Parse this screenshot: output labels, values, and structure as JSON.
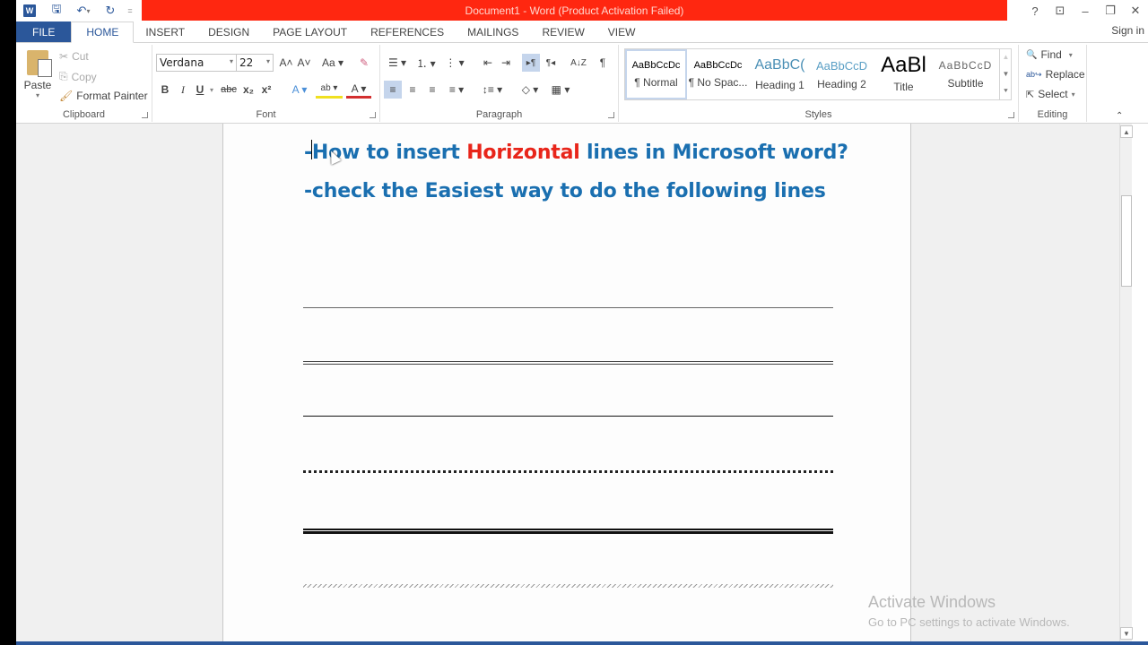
{
  "window": {
    "title": "Document1 -  Word (Product Activation Failed)",
    "controls": {
      "help": "?",
      "ribbon_options": "⊡",
      "minimize": "–",
      "restore": "❐",
      "close": "✕"
    },
    "sign_in": "Sign in"
  },
  "qat": {
    "word_logo": "W",
    "save": "🖫",
    "undo": "↶",
    "undo_dd": "▾",
    "redo": "↻",
    "customize": "="
  },
  "tabs": [
    {
      "label": "FILE"
    },
    {
      "label": "HOME"
    },
    {
      "label": "INSERT"
    },
    {
      "label": "DESIGN"
    },
    {
      "label": "PAGE LAYOUT"
    },
    {
      "label": "REFERENCES"
    },
    {
      "label": "MAILINGS"
    },
    {
      "label": "REVIEW"
    },
    {
      "label": "VIEW"
    }
  ],
  "active_tab": "HOME",
  "ribbon": {
    "clipboard": {
      "label": "Clipboard",
      "paste": "Paste",
      "paste_dd": "▾",
      "cut": "Cut",
      "copy": "Copy",
      "format_painter": "Format Painter",
      "cut_icon": "✂",
      "copy_icon": "⎘",
      "fp_icon": "🖌"
    },
    "font": {
      "label": "Font",
      "font_name": "Verdana",
      "font_size": "22",
      "dd": "▾",
      "grow": "A˄",
      "shrink": "A˅",
      "change_case": "Aa ▾",
      "clear": "✎",
      "bold": "B",
      "italic": "I",
      "underline": "U",
      "underline_dd": "▾",
      "strike": "abc",
      "subscript": "x₂",
      "superscript": "x²",
      "text_effects": "A ▾",
      "highlight": "ab ▾",
      "font_color": "A ▾",
      "highlight_color": "#f0e020",
      "font_color_value": "#d32f2f"
    },
    "paragraph": {
      "label": "Paragraph",
      "bullets": "☰ ▾",
      "numbering": "⒈ ▾",
      "multilevel": "⋮ ▾",
      "dec_indent": "⇤",
      "inc_indent": "⇥",
      "ltr": "▸¶",
      "rtl": "¶◂",
      "sort": "A↓Z",
      "show_marks": "¶",
      "align_left": "≡",
      "center": "≡",
      "align_right": "≡",
      "justify": "≡ ▾",
      "line_spacing": "↕≡ ▾",
      "shading": "◇ ▾",
      "borders": "▦ ▾"
    },
    "styles": {
      "label": "Styles",
      "items": [
        {
          "preview": "AaBbCcDc",
          "name": "¶ Normal",
          "selected": true
        },
        {
          "preview": "AaBbCcDc",
          "name": "¶ No Spac...",
          "selected": false
        },
        {
          "preview": "AaBbC(",
          "name": "Heading 1",
          "selected": false
        },
        {
          "preview": "AaBbCcD",
          "name": "Heading 2",
          "selected": false
        },
        {
          "preview": "AaBl",
          "name": "Title",
          "selected": false
        },
        {
          "preview": "AaBbCcD",
          "name": "Subtitle",
          "selected": false
        }
      ],
      "scroll_up": "▲",
      "scroll_down": "▼",
      "more": "⯆"
    },
    "editing": {
      "label": "Editing",
      "find": "Find",
      "find_dd": "▾",
      "replace": "Replace",
      "select": "Select",
      "select_dd": "▾",
      "find_icon": "🔍",
      "replace_icon": "ab↪",
      "select_icon": "⇱"
    },
    "collapse": "⌃"
  },
  "document": {
    "line1_prefix": "-How to insert ",
    "line1_highlight": "Horizontal",
    "line1_suffix": " lines in Microsoft word?",
    "line2": "-check the Easiest way to do the following lines",
    "text_color": "#1a6fb0",
    "highlight_color": "#e8251a",
    "horizontal_lines": [
      "single thin",
      "double thin",
      "single thick",
      "dotted",
      "triple",
      "wavy"
    ]
  },
  "watermark": {
    "title": "Activate Windows",
    "subtitle": "Go to PC settings to activate Windows."
  },
  "scrollbar": {
    "up": "▲",
    "down": "▼"
  }
}
